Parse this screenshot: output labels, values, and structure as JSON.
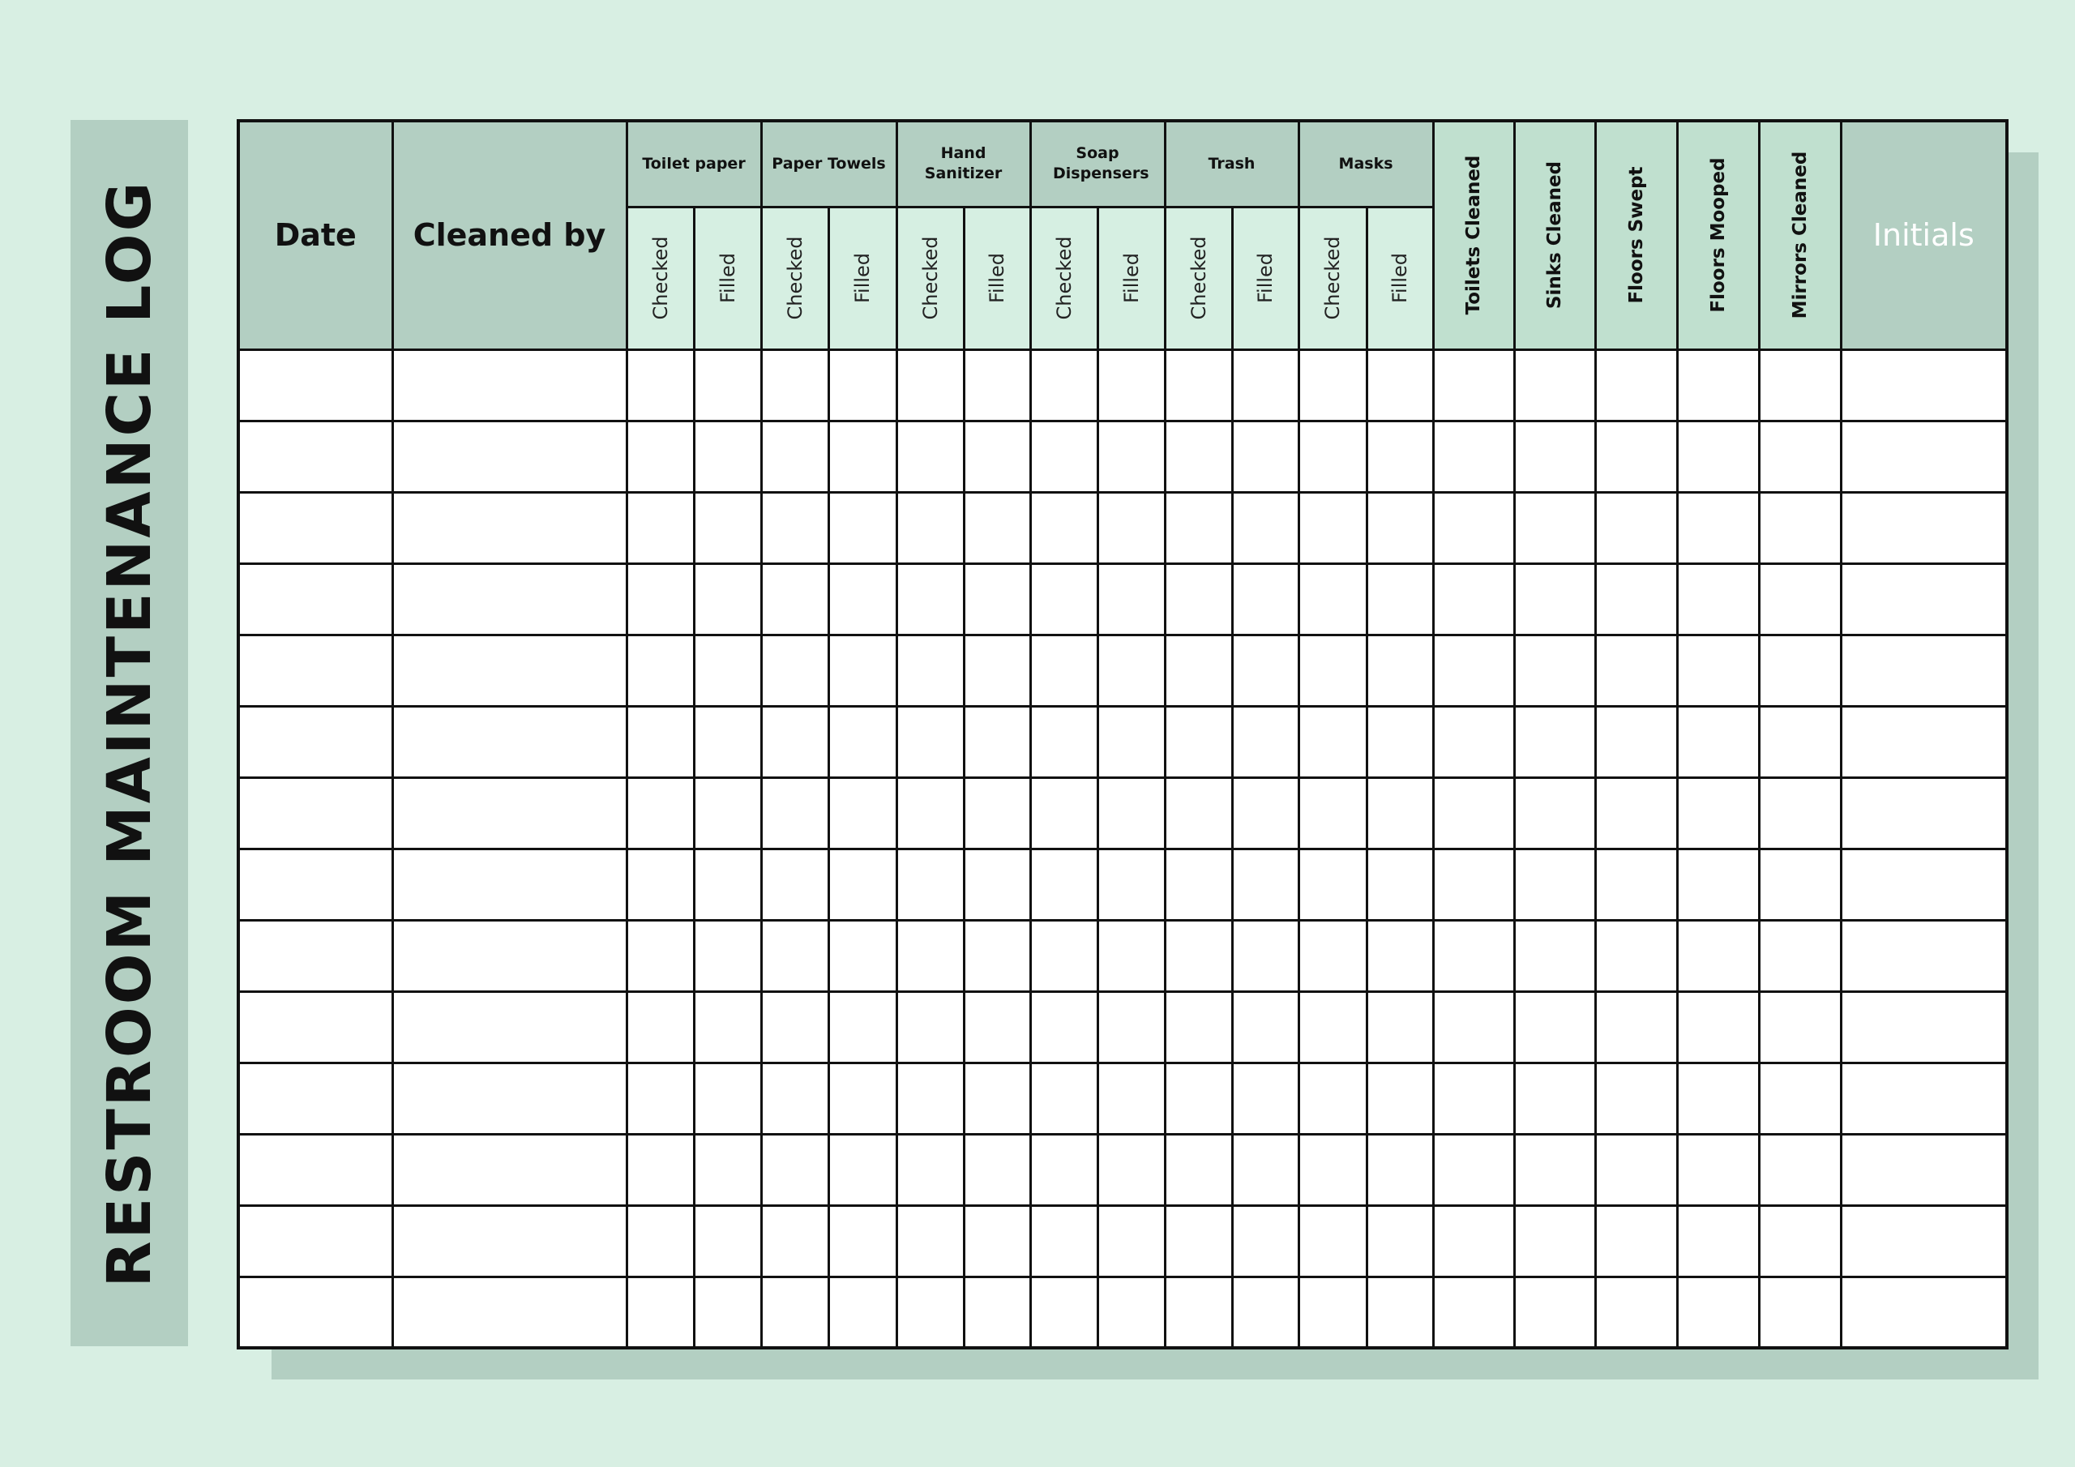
{
  "title": "RESTROOM MAINTENANCE LOG",
  "colors": {
    "background": "#d8efe3",
    "header_dark": "#b3cfc2",
    "header_sub": "#d6efe2",
    "header_single": "#c0e0cf",
    "grid": "#111111",
    "initials_text": "#ffffff"
  },
  "table": {
    "date_header": "Date",
    "cleaned_by_header": "Cleaned by",
    "groups": [
      {
        "label": "Toilet paper",
        "sub": [
          "Checked",
          "Filled"
        ]
      },
      {
        "label": "Paper Towels",
        "sub": [
          "Checked",
          "Filled"
        ]
      },
      {
        "label": "Hand Sanitizer",
        "sub": [
          "Checked",
          "Filled"
        ]
      },
      {
        "label": "Soap Dispensers",
        "sub": [
          "Checked",
          "Filled"
        ]
      },
      {
        "label": "Trash",
        "sub": [
          "Checked",
          "Filled"
        ]
      },
      {
        "label": "Masks",
        "sub": [
          "Checked",
          "Filled"
        ]
      }
    ],
    "singles": [
      "Toilets Cleaned",
      "Sinks Cleaned",
      "Floors Swept",
      "Floors Mooped",
      "Mirrors Cleaned"
    ],
    "initials_header": "Initials",
    "row_count": 14,
    "rows": [
      [
        "",
        "",
        "",
        "",
        "",
        "",
        "",
        "",
        "",
        "",
        "",
        "",
        "",
        "",
        "",
        "",
        "",
        "",
        "",
        ""
      ],
      [
        "",
        "",
        "",
        "",
        "",
        "",
        "",
        "",
        "",
        "",
        "",
        "",
        "",
        "",
        "",
        "",
        "",
        "",
        "",
        ""
      ],
      [
        "",
        "",
        "",
        "",
        "",
        "",
        "",
        "",
        "",
        "",
        "",
        "",
        "",
        "",
        "",
        "",
        "",
        "",
        "",
        ""
      ],
      [
        "",
        "",
        "",
        "",
        "",
        "",
        "",
        "",
        "",
        "",
        "",
        "",
        "",
        "",
        "",
        "",
        "",
        "",
        "",
        ""
      ],
      [
        "",
        "",
        "",
        "",
        "",
        "",
        "",
        "",
        "",
        "",
        "",
        "",
        "",
        "",
        "",
        "",
        "",
        "",
        "",
        ""
      ],
      [
        "",
        "",
        "",
        "",
        "",
        "",
        "",
        "",
        "",
        "",
        "",
        "",
        "",
        "",
        "",
        "",
        "",
        "",
        "",
        ""
      ],
      [
        "",
        "",
        "",
        "",
        "",
        "",
        "",
        "",
        "",
        "",
        "",
        "",
        "",
        "",
        "",
        "",
        "",
        "",
        "",
        ""
      ],
      [
        "",
        "",
        "",
        "",
        "",
        "",
        "",
        "",
        "",
        "",
        "",
        "",
        "",
        "",
        "",
        "",
        "",
        "",
        "",
        ""
      ],
      [
        "",
        "",
        "",
        "",
        "",
        "",
        "",
        "",
        "",
        "",
        "",
        "",
        "",
        "",
        "",
        "",
        "",
        "",
        "",
        ""
      ],
      [
        "",
        "",
        "",
        "",
        "",
        "",
        "",
        "",
        "",
        "",
        "",
        "",
        "",
        "",
        "",
        "",
        "",
        "",
        "",
        ""
      ],
      [
        "",
        "",
        "",
        "",
        "",
        "",
        "",
        "",
        "",
        "",
        "",
        "",
        "",
        "",
        "",
        "",
        "",
        "",
        "",
        ""
      ],
      [
        "",
        "",
        "",
        "",
        "",
        "",
        "",
        "",
        "",
        "",
        "",
        "",
        "",
        "",
        "",
        "",
        "",
        "",
        "",
        ""
      ],
      [
        "",
        "",
        "",
        "",
        "",
        "",
        "",
        "",
        "",
        "",
        "",
        "",
        "",
        "",
        "",
        "",
        "",
        "",
        "",
        ""
      ],
      [
        "",
        "",
        "",
        "",
        "",
        "",
        "",
        "",
        "",
        "",
        "",
        "",
        "",
        "",
        "",
        "",
        "",
        "",
        "",
        ""
      ]
    ]
  }
}
